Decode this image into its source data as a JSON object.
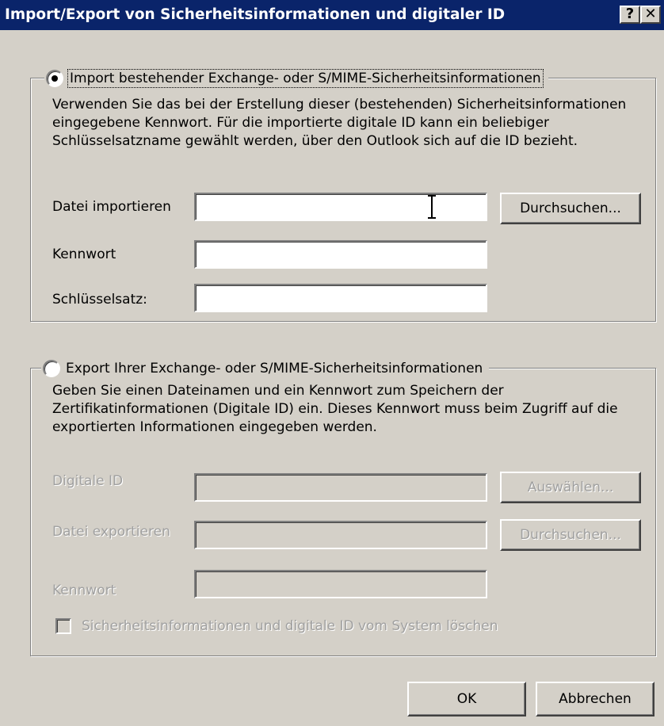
{
  "window": {
    "title": "Import/Export von Sicherheitsinformationen und digitaler ID",
    "help_label": "?",
    "close_label": "✕"
  },
  "import_section": {
    "radio_label": "Import bestehender Exchange- oder S/MIME-Sicherheitsinformationen",
    "selected": true,
    "description": "Verwenden Sie das bei der Erstellung dieser (bestehenden) Sicherheitsinformationen eingegebene Kennwort. Für die importierte digitale ID kann ein beliebiger Schlüsselsatzname gewählt werden, über den Outlook sich auf die ID bezieht.",
    "file_label": "Datei importieren",
    "file_value": "",
    "browse_button": "Durchsuchen...",
    "password_label": "Kennwort",
    "password_value": "",
    "keyset_label": "Schlüsselsatz:",
    "keyset_value": ""
  },
  "export_section": {
    "radio_label": "Export Ihrer Exchange- oder S/MIME-Sicherheitsinformationen",
    "selected": false,
    "description": "Geben Sie einen Dateinamen und ein Kennwort zum Speichern der Zertifikatinformationen (Digitale ID) ein. Dieses Kennwort muss beim Zugriff auf die exportierten Informationen eingegeben werden.",
    "digital_id_label": "Digitale ID",
    "digital_id_value": "",
    "select_button": "Auswählen...",
    "file_label": "Datei exportieren",
    "file_value": "",
    "browse_button": "Durchsuchen...",
    "password_label": "Kennwort",
    "password_value": "",
    "delete_checkbox_label": "Sicherheitsinformationen und digitale ID vom System löschen"
  },
  "footer": {
    "ok_button": "OK",
    "cancel_button": "Abbrechen"
  },
  "colors": {
    "titlebar": "#0a246a",
    "dialog_face": "#d4d0c8",
    "disabled_text": "#a0a0a0"
  }
}
